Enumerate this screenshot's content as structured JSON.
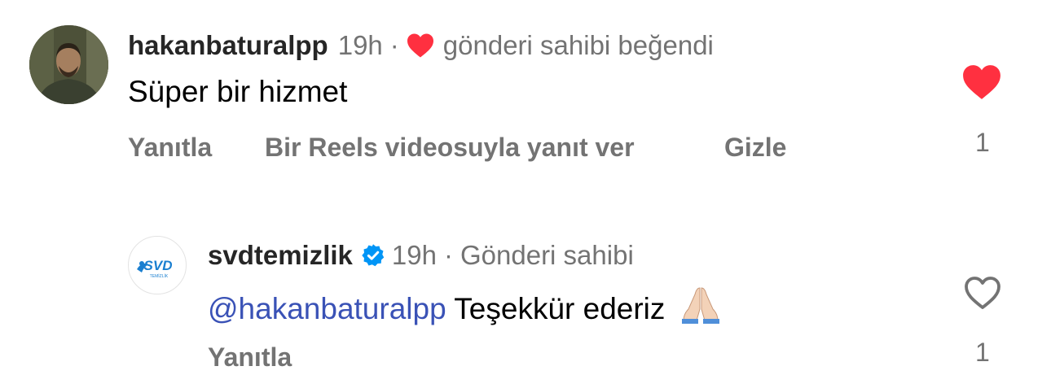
{
  "comments": [
    {
      "username": "hakanbaturalpp",
      "time": "19h",
      "separator": "·",
      "liked_by_author_text": "gönderi sahibi beğendi",
      "text": "Süper bir hizmet",
      "actions": [
        "Yanıtla",
        "Bir Reels videosuyla yanıt ver",
        "Gizle"
      ],
      "like_count": "1",
      "liked": true,
      "avatar": "user-photo"
    },
    {
      "username": "svdtemizlik",
      "verified": true,
      "time": "19h",
      "separator": "·",
      "author_label": "Gönderi sahibi",
      "mention": "@hakanbaturalpp",
      "text": "Teşekkür ederiz",
      "emoji": "🙏🏻",
      "actions": [
        "Yanıtla"
      ],
      "like_count": "1",
      "liked": false,
      "avatar": "svd-logo",
      "logo_text": "SVD",
      "logo_subtext": "TEMİZLİK"
    }
  ],
  "colors": {
    "like_red": "#ff3040",
    "verified_blue": "#0095f6",
    "mention_blue": "#3a52b6",
    "secondary_text": "#737373",
    "logo_blue": "#1a7fd0"
  }
}
